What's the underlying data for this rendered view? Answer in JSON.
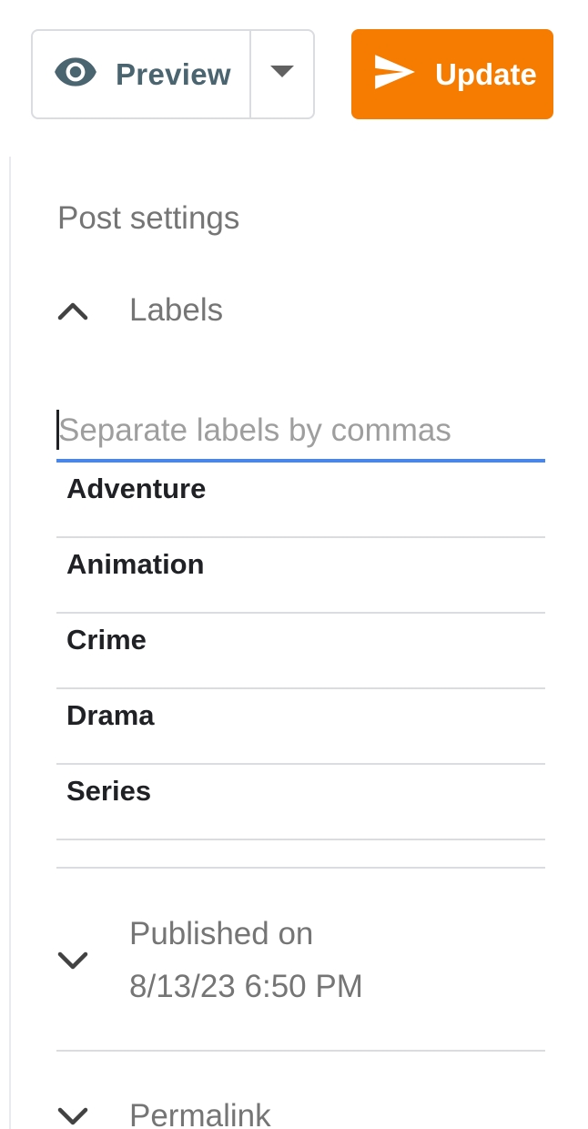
{
  "toolbar": {
    "preview_label": "Preview",
    "update_label": "Update",
    "accent_color": "#f57c00"
  },
  "post_settings": {
    "title": "Post settings",
    "labels_section": {
      "title": "Labels",
      "expanded": true,
      "input_placeholder": "Separate labels by commas",
      "input_value": "",
      "items": [
        {
          "label": "Adventure"
        },
        {
          "label": "Animation"
        },
        {
          "label": "Crime"
        },
        {
          "label": "Drama"
        },
        {
          "label": "Series"
        }
      ]
    },
    "published_section": {
      "line1": "Published on",
      "line2": "8/13/23 6:50 PM",
      "expanded": false
    },
    "permalink_section": {
      "title": "Permalink",
      "expanded": false
    }
  },
  "icons": {
    "preview": "eye-icon",
    "preview_menu": "dropdown-arrow-icon",
    "update": "send-icon",
    "labels_toggle": "chevron-up-icon",
    "published_toggle": "chevron-down-icon",
    "permalink_toggle": "chevron-down-icon"
  }
}
